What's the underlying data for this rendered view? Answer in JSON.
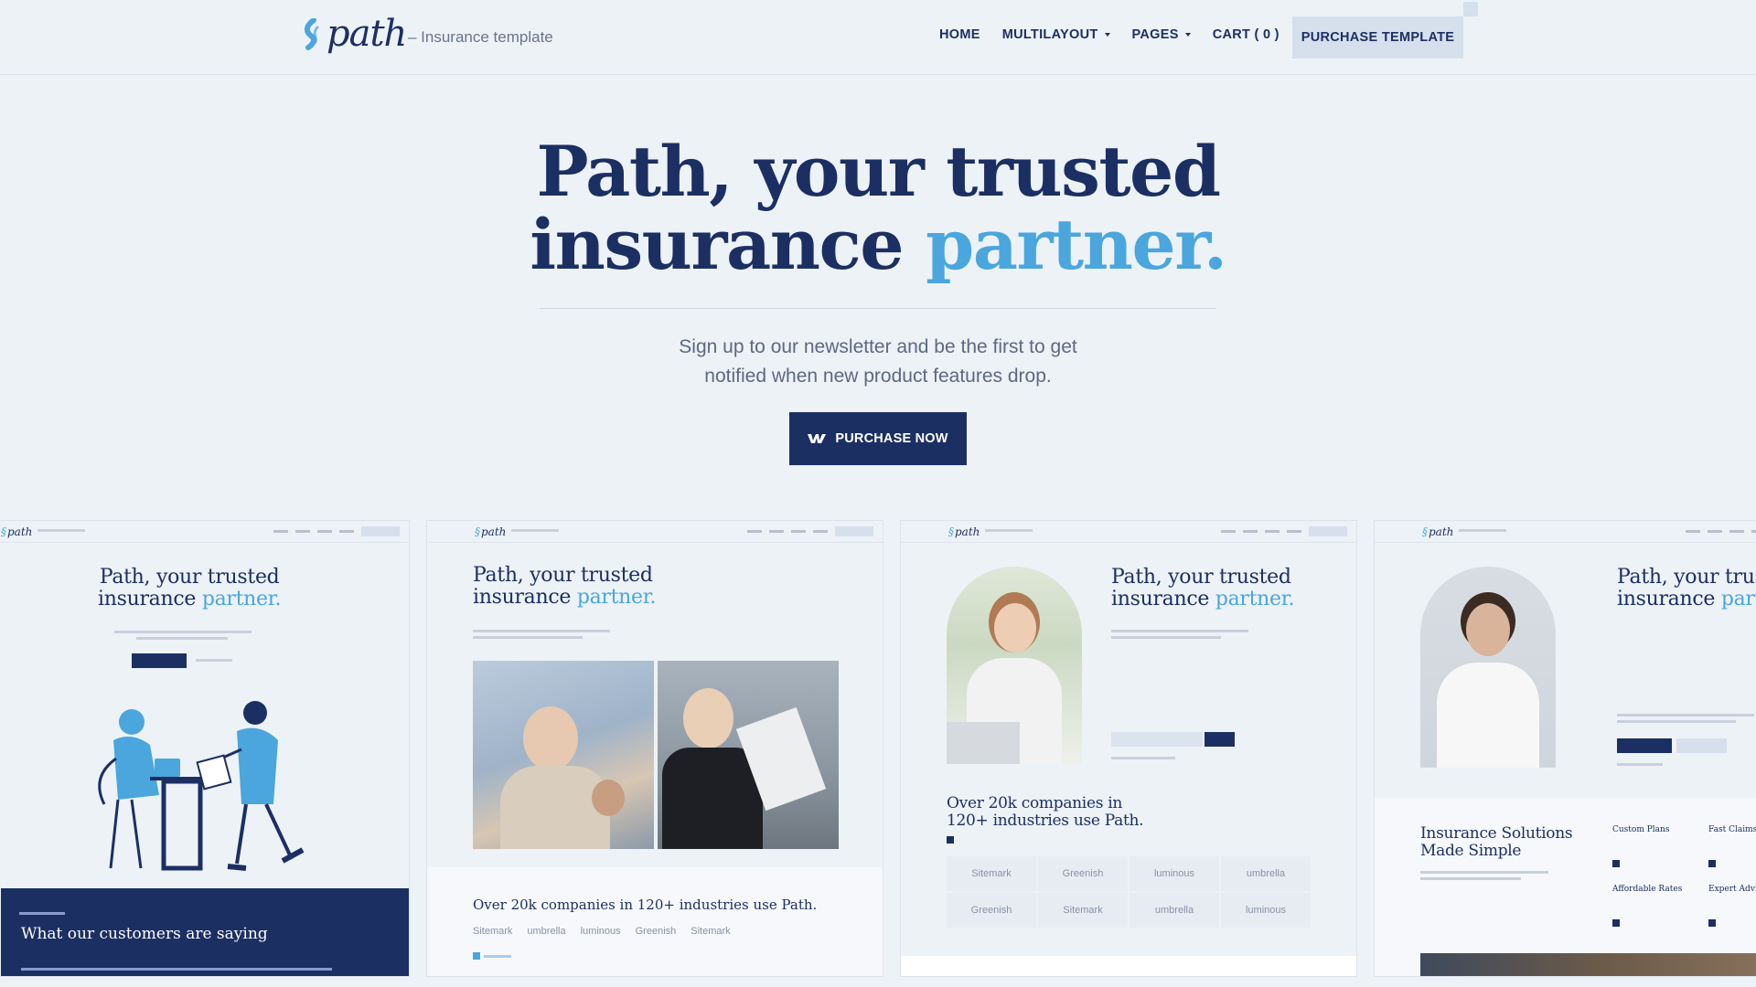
{
  "brand": {
    "logo_text": "path",
    "tagline": "– Insurance template"
  },
  "nav": {
    "items": [
      {
        "label": "HOME",
        "dropdown": false
      },
      {
        "label": "MULTILAYOUT",
        "dropdown": true
      },
      {
        "label": "PAGES",
        "dropdown": true
      },
      {
        "label": "CART ( 0 )",
        "dropdown": false
      }
    ],
    "cta_label": "PURCHASE TEMPLATE"
  },
  "hero": {
    "title_line1": "Path, your trusted",
    "title_line2_a": "insurance ",
    "title_line2_b": "partner.",
    "subtitle_line1": "Sign up to our newsletter and be the first to get",
    "subtitle_line2": "notified when new product features drop.",
    "button_label": "PURCHASE NOW"
  },
  "previews": {
    "card1": {
      "title_a": "Path, your trusted",
      "title_b": "insurance ",
      "title_c": "partner.",
      "section_title": "What our customers are saying"
    },
    "card2": {
      "title_a": "Path, your trusted",
      "title_b": "insurance ",
      "title_c": "partner.",
      "section_title": "Over 20k companies in 120+ industries use Path.",
      "logos": [
        "Sitemark",
        "umbrella",
        "luminous",
        "Greenish",
        "Sitemark"
      ]
    },
    "card3": {
      "title_a": "Path, your trusted",
      "title_b": "insurance ",
      "title_c": "partner.",
      "section_title_1": "Over 20k companies in",
      "section_title_2": "120+ industries use Path.",
      "logos": [
        "Sitemark",
        "Greenish",
        "luminous",
        "umbrella",
        "Greenish",
        "Sitemark",
        "umbrella",
        "luminous"
      ]
    },
    "card4": {
      "title_a": "Path, your trust",
      "title_b": "insurance ",
      "title_c": "part",
      "section_title_1": "Insurance Solutions",
      "section_title_2": "Made Simple",
      "features": [
        "Custom Plans",
        "Fast Claims",
        "Affordable Rates",
        "Expert Advice"
      ]
    }
  },
  "colors": {
    "navy": "#1c2f63",
    "accent": "#4aa6dd",
    "background": "#edf2f7"
  }
}
